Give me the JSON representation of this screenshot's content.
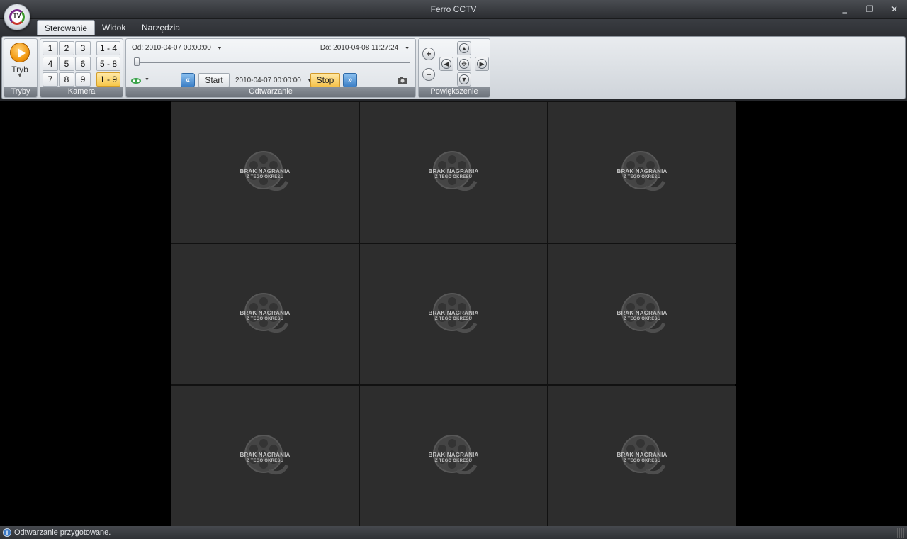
{
  "window": {
    "title": "Ferro CCTV",
    "logo_text": "TV",
    "minimize": "‗",
    "maximize": "❐",
    "close": "✕"
  },
  "tabs": [
    {
      "label": "Sterowanie",
      "active": true
    },
    {
      "label": "Widok",
      "active": false
    },
    {
      "label": "Narzędzia",
      "active": false
    }
  ],
  "ribbon": {
    "tryby": {
      "button_label": "Tryb",
      "group_label": "Tryby"
    },
    "kamera": {
      "group_label": "Kamera",
      "cameras": [
        "1",
        "2",
        "3",
        "4",
        "5",
        "6",
        "7",
        "8",
        "9"
      ],
      "ranges": [
        {
          "label": "1 - 4",
          "active": false
        },
        {
          "label": "5 - 8",
          "active": false
        },
        {
          "label": "1 - 9",
          "active": true
        }
      ]
    },
    "odtwarzanie": {
      "group_label": "Odtwarzanie",
      "from": "Od: 2010-04-07 00:00:00",
      "to": "Do: 2010-04-08 11:27:24",
      "start_label": "Start",
      "current_time": "2010-04-07 00:00:00",
      "stop_label": "Stop",
      "prev_label": "«",
      "next_label": "»",
      "slider_position": 0
    },
    "powiekszenie": {
      "group_label": "Powiększenie"
    }
  },
  "grid": {
    "cells": [
      {
        "line1": "BRAK NAGRANIA",
        "line2": "Z TEGO OKRESU"
      },
      {
        "line1": "BRAK NAGRANIA",
        "line2": "Z TEGO OKRESU"
      },
      {
        "line1": "BRAK NAGRANIA",
        "line2": "Z TEGO OKRESU"
      },
      {
        "line1": "BRAK NAGRANIA",
        "line2": "Z TEGO OKRESU"
      },
      {
        "line1": "BRAK NAGRANIA",
        "line2": "Z TEGO OKRESU"
      },
      {
        "line1": "BRAK NAGRANIA",
        "line2": "Z TEGO OKRESU"
      },
      {
        "line1": "BRAK NAGRANIA",
        "line2": "Z TEGO OKRESU"
      },
      {
        "line1": "BRAK NAGRANIA",
        "line2": "Z TEGO OKRESU"
      },
      {
        "line1": "BRAK NAGRANIA",
        "line2": "Z TEGO OKRESU"
      }
    ]
  },
  "status": {
    "message": "Odtwarzanie przygotowane."
  }
}
